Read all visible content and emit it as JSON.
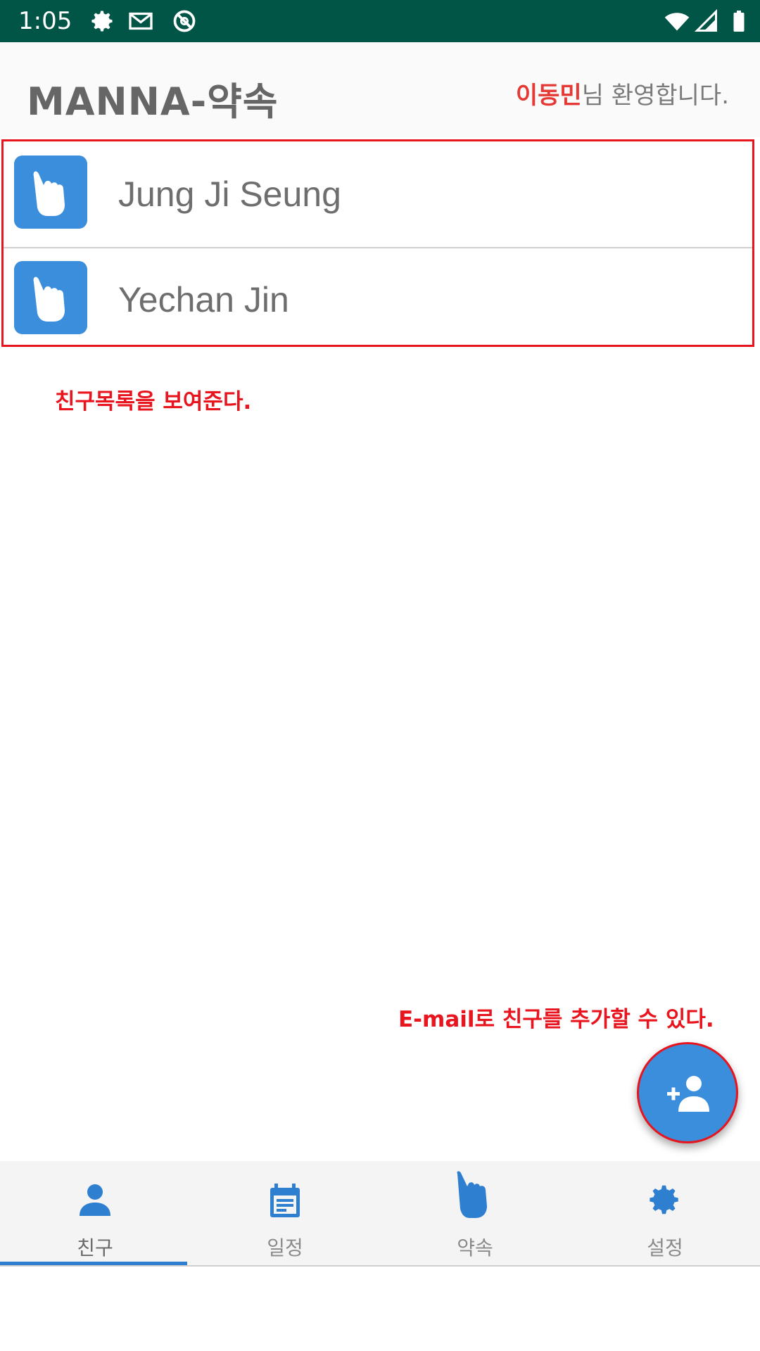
{
  "status_bar": {
    "time": "1:05",
    "icons_left": [
      "gear-icon",
      "gmail-icon",
      "blocked-icon"
    ],
    "icons_right": [
      "wifi-icon",
      "signal-icon",
      "battery-icon"
    ]
  },
  "app_bar": {
    "title": "MANNA-약속",
    "user_name": "이동민",
    "welcome_suffix": "님 환영합니다."
  },
  "friends": [
    {
      "name": "Jung Ji Seung",
      "icon": "pointing-hand-icon"
    },
    {
      "name": "Yechan Jin",
      "icon": "pointing-hand-icon"
    }
  ],
  "annotations": {
    "list_note": "친구목록을 보여준다.",
    "fab_note": "E-mail로 친구를 추가할 수 있다."
  },
  "fab": {
    "icon": "add-person-icon"
  },
  "bottom_nav": [
    {
      "label": "친구",
      "icon": "person-icon",
      "active": true
    },
    {
      "label": "일정",
      "icon": "calendar-icon",
      "active": false
    },
    {
      "label": "약속",
      "icon": "pointing-hand-icon",
      "active": false
    },
    {
      "label": "설정",
      "icon": "gear-icon",
      "active": false
    }
  ],
  "colors": {
    "status_bar": "#005546",
    "accent_blue": "#3a8edb",
    "annotation_red": "#e8141e"
  }
}
